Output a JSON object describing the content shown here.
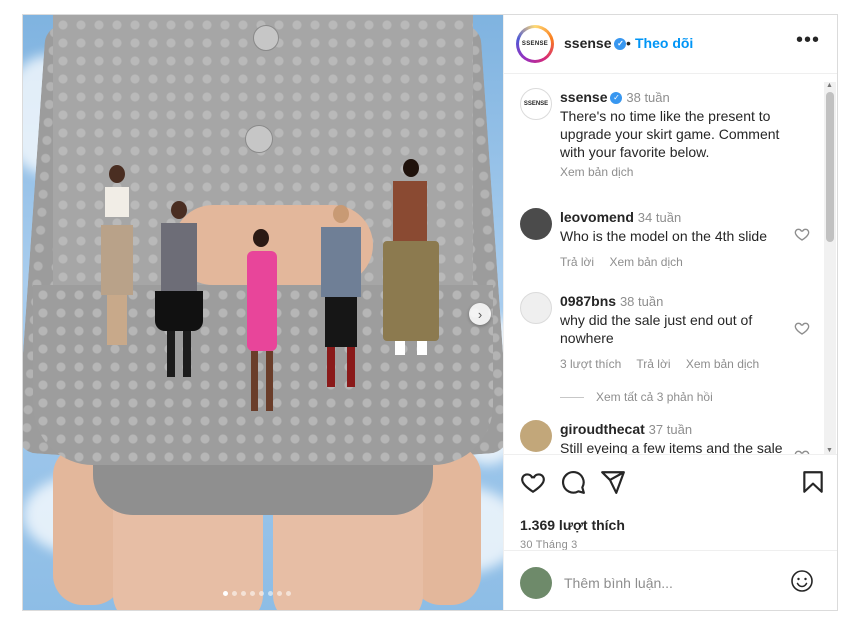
{
  "post": {
    "username": "ssense",
    "avatar_text": "SSENSE",
    "follow_label": "Theo dõi",
    "separator": "•",
    "more_icon": "more-icon",
    "image_dots_count": 8,
    "active_dot_index": 0
  },
  "caption": {
    "username": "ssense",
    "time": "38 tuần",
    "text": "There's no time like the present to upgrade your skirt game. Comment with your favorite below.",
    "translate_label": "Xem bản dịch"
  },
  "comments": [
    {
      "username": "leovomend",
      "time": "34 tuần",
      "text": "Who is the model on the 4th slide",
      "reply_label": "Trả lời",
      "translate_label": "Xem bản dịch"
    },
    {
      "username": "0987bns",
      "time": "38 tuần",
      "text": "why did the sale just end out of nowhere",
      "likes_label": "3 lượt thích",
      "reply_label": "Trả lời",
      "translate_label": "Xem bản dịch",
      "view_replies_label": "Xem tất cả 3 phản hồi"
    },
    {
      "username": "giroudthecat",
      "time": "37 tuần",
      "text": "Still eyeing a few items and the sale just evaporated 😭"
    }
  ],
  "stats": {
    "likes": "1.369 lượt thích",
    "date": "30 Tháng 3"
  },
  "add_comment": {
    "placeholder": "Thêm bình luận..."
  },
  "colors": {
    "follow": "#0095f6",
    "verified": "#3897f0",
    "muted": "#8e8e8e"
  }
}
